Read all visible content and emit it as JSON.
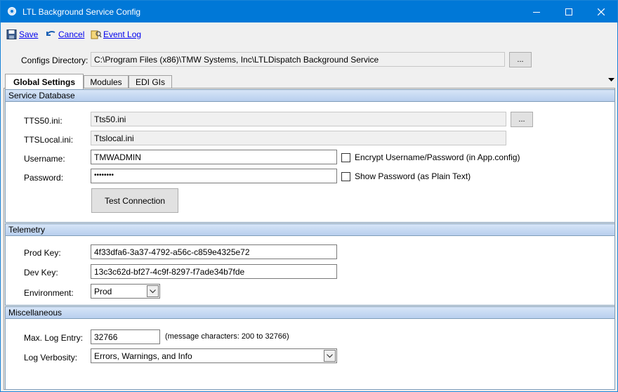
{
  "window": {
    "title": "LTL Background Service Config"
  },
  "toolbar": {
    "save_label": "Save",
    "cancel_label": "Cancel",
    "eventlog_label": "Event Log"
  },
  "configs_dir": {
    "label": "Configs Directory:",
    "value": "C:\\Program Files (x86)\\TMW Systems, Inc\\LTLDispatch Background Service",
    "browse_label": "..."
  },
  "tabs": [
    {
      "label": "Global Settings",
      "active": true
    },
    {
      "label": "Modules",
      "active": false
    },
    {
      "label": "EDI GIs",
      "active": false
    }
  ],
  "service_db": {
    "header": "Service Database",
    "tts50_label": "TTS50.ini:",
    "tts50_value": "Tts50.ini",
    "tts50_browse": "...",
    "ttslocal_label": "TTSLocal.ini:",
    "ttslocal_value": "Ttslocal.ini",
    "username_label": "Username:",
    "username_value": "TMWADMIN",
    "encrypt_label": "Encrypt Username/Password (in App.config)",
    "password_label": "Password:",
    "password_value": "••••••••",
    "show_password_label": "Show Password (as Plain Text)",
    "test_button": "Test Connection"
  },
  "telemetry": {
    "header": "Telemetry",
    "prod_label": "Prod Key:",
    "prod_value": "4f33dfa6-3a37-4792-a56c-c859e4325e72",
    "dev_label": "Dev Key:",
    "dev_value": "13c3c62d-bf27-4c9f-8297-f7ade34b7fde",
    "env_label": "Environment:",
    "env_value": "Prod"
  },
  "misc": {
    "header": "Miscellaneous",
    "maxlog_label": "Max. Log Entry:",
    "maxlog_value": "32766",
    "maxlog_hint": "(message characters: 200 to 32766)",
    "verbosity_label": "Log Verbosity:",
    "verbosity_value": "Errors, Warnings, and Info"
  },
  "colors": {
    "titlebar": "#0078d7",
    "link": "#0000ee",
    "group_header": "#c4d8f2"
  }
}
